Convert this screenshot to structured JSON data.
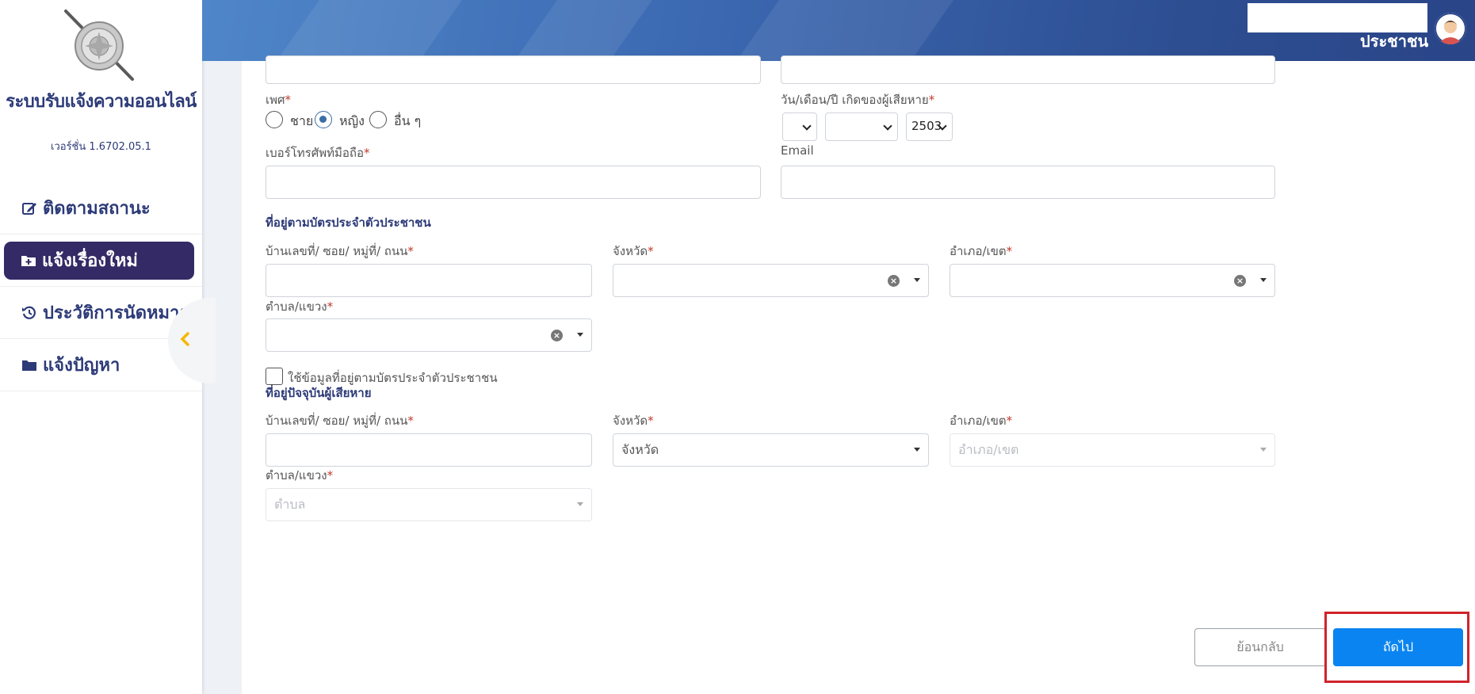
{
  "sidebar": {
    "app_title": "ระบบรับแจ้งความออนไลน์",
    "version": "เวอร์ชั่น 1.6702.05.1",
    "items": [
      {
        "label": "ติดตามสถานะ",
        "icon": "edit-icon"
      },
      {
        "label": "แจ้งเรื่องใหม่",
        "icon": "folder-plus-icon",
        "active": true
      },
      {
        "label": "ประวัติการนัดหมาย",
        "icon": "history-icon"
      },
      {
        "label": "แจ้งปัญหา",
        "icon": "folder-icon"
      }
    ],
    "active_color": "#332a66"
  },
  "header": {
    "user_role": "ประชาชน"
  },
  "form": {
    "gender_label": "เพศ",
    "gender_options": [
      "ชาย",
      "หญิง",
      "อื่น ๆ"
    ],
    "gender_selected": "หญิง",
    "dob_label": "วัน/เดือน/ปี เกิดของผู้เสียหาย",
    "dob_day": "",
    "dob_month": "",
    "dob_year": "2503",
    "mobile_label": "เบอร์โทรศัพท์มือถือ",
    "email_label": "Email",
    "id_address": {
      "section_title": "ที่อยู่ตามบัตรประจำตัวประชาชน",
      "house_label": "บ้านเลขที่/ ซอย/ หมู่ที่/ ถนน",
      "province_label": "จังหวัด",
      "district_label": "อำเภอ/เขต",
      "subdistrict_label": "ตำบล/แขวง"
    },
    "same_address_checkbox": "ใช้ข้อมูลที่อยู่ตามบัตรประจำตัวประชาชน",
    "current_address": {
      "section_title": "ที่อยู่ปัจจุบันผู้เสียหาย",
      "house_label": "บ้านเลขที่/ ซอย/ หมู่ที่/ ถนน",
      "province_label": "จังหวัด",
      "province_placeholder": "จังหวัด",
      "district_label": "อำเภอ/เขต",
      "district_placeholder": "อำเภอ/เขต",
      "subdistrict_label": "ตำบล/แขวง",
      "subdistrict_placeholder": "ตำบล"
    },
    "required_mark": "*",
    "back_button": "ย้อนกลับ",
    "next_button": "ถัดไป"
  },
  "colors": {
    "primary_button": "#0a84f0",
    "highlight_border": "#d0232a",
    "heading": "#2c3a78"
  }
}
